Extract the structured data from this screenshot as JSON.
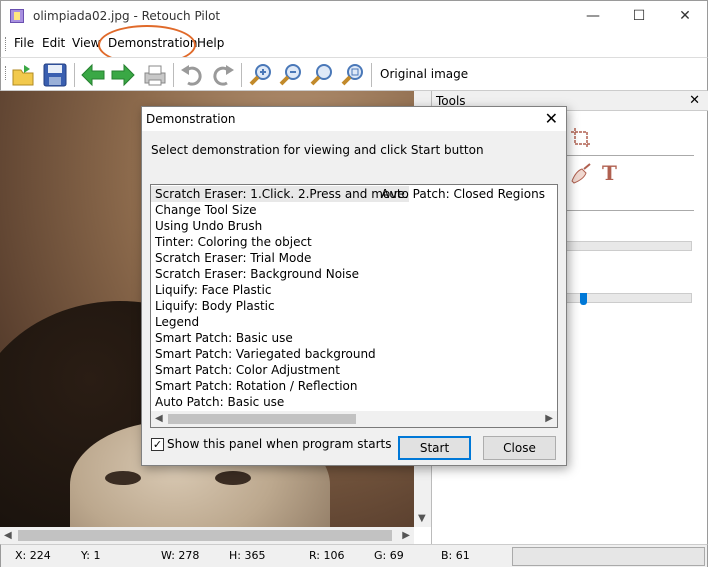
{
  "window": {
    "title": "olimpiada02.jpg - Retouch Pilot",
    "minimize": "—",
    "maximize": "☐",
    "close": "✕"
  },
  "menu": [
    "File",
    "Edit",
    "View",
    "Demonstration",
    "Help"
  ],
  "toolbar": {
    "original_image_label": "Original image",
    "buttons": [
      "open-icon",
      "save-icon",
      "back-arrow-icon",
      "forward-arrow-icon",
      "print-icon",
      "undo-icon",
      "redo-icon",
      "zoom-in-icon",
      "zoom-out-icon",
      "zoom-fit-icon",
      "zoom-actual-icon"
    ]
  },
  "tools_panel": {
    "title": "Tools",
    "close": "✕",
    "text_tool": "T"
  },
  "status": {
    "x": "X: 224",
    "y": "Y: 1",
    "w": "W: 278",
    "h": "H: 365",
    "r": "R: 106",
    "g": "G: 69",
    "b": "B: 61"
  },
  "dialog": {
    "title": "Demonstration",
    "close": "✕",
    "instruction": "Select demonstration for viewing and click Start button",
    "items_col1": [
      "Scratch Eraser: 1.Click. 2.Press and move.",
      "Change Tool Size",
      "Using Undo Brush",
      "Tinter: Coloring the object",
      "Scratch Eraser: Trial Mode",
      "Scratch Eraser: Background Noise",
      "Liquify: Face Plastic",
      "Liquify: Body Plastic",
      "Legend",
      "Smart Patch: Basic use",
      "Smart Patch: Variegated background",
      "Smart Patch: Color Adjustment",
      "Smart Patch: Rotation / Reflection",
      "Auto Patch: Basic use"
    ],
    "items_col2": [
      "Auto Patch: Closed Regions"
    ],
    "checkbox_label": "Show this panel when program starts",
    "checkbox_mark": "✓",
    "start_label": "Start",
    "close_label": "Close"
  },
  "colors": {
    "accent": "#0078d7",
    "highlight_ring": "#e06a2a",
    "green_arrow": "#3aa845"
  }
}
